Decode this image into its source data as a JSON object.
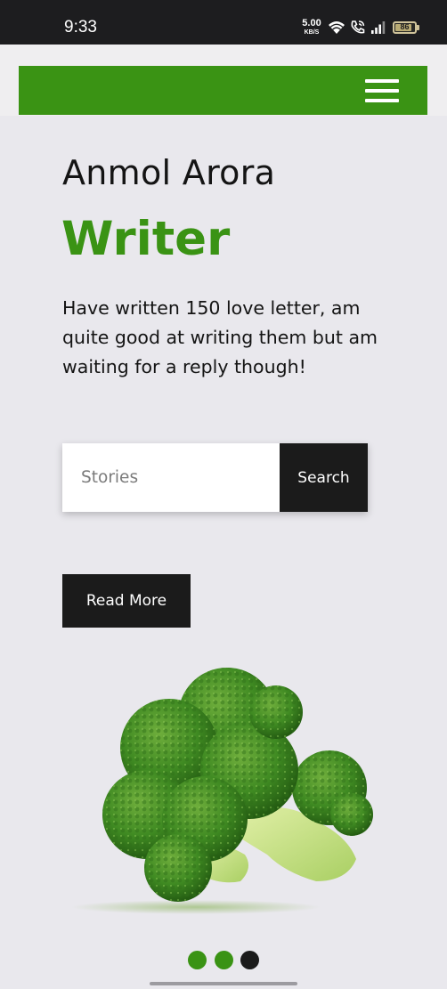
{
  "status_bar": {
    "time": "9:33",
    "net_speed_value": "5.00",
    "net_speed_unit": "KB/S",
    "battery_level": "86",
    "battery_fraction": 0.86,
    "icons": [
      "wifi-icon",
      "call-icon",
      "signal-icon",
      "battery-icon"
    ]
  },
  "navbar": {
    "color": "#3a9314",
    "menu_icon": "hamburger-menu-icon"
  },
  "hero": {
    "name": "Anmol Arora",
    "role": "Writer",
    "description": "Have written 150 love letter, am quite good at writing them but am waiting for a reply though!",
    "accent_color": "#3a9314"
  },
  "search": {
    "placeholder": "Stories",
    "value": "",
    "button_label": "Search"
  },
  "read_more": {
    "label": "Read More"
  },
  "image": {
    "subject": "broccoli"
  },
  "carousel": {
    "dot_count": 3,
    "active_index": 2
  }
}
